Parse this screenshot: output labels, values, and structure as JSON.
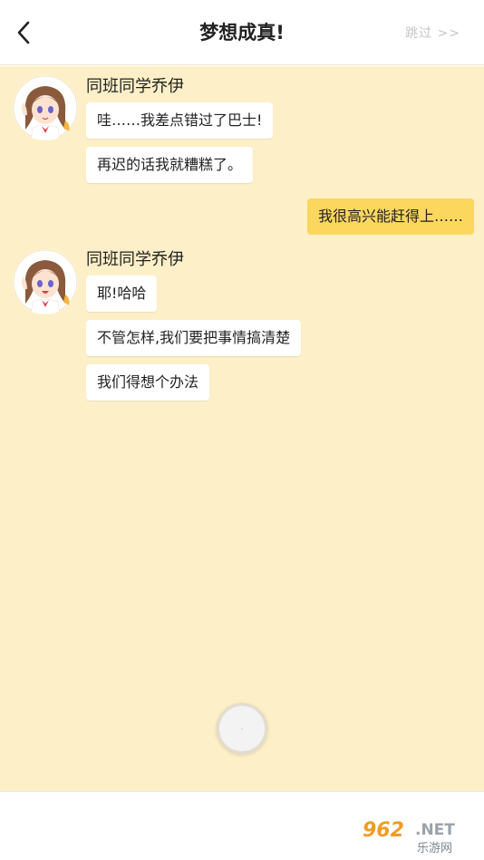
{
  "header": {
    "title": "梦想成真!",
    "skip_label": "跳过 >>",
    "back_icon": "chevron-left-icon"
  },
  "chat": {
    "background": "#fdefc7",
    "messages_group_1": {
      "speaker": "同班同学乔伊",
      "bubbles": [
        "哇……我差点错过了巴士!",
        "再迟的话我就糟糕了。"
      ]
    },
    "self_message": "我很高兴能赶得上……",
    "messages_group_2": {
      "speaker": "同班同学乔伊",
      "bubbles": [
        "耶!哈哈",
        "不管怎样,我们要把事情搞清楚",
        "我们得想个办法"
      ]
    }
  },
  "colors": {
    "self_bubble": "#fcd75e",
    "chat_bg": "#fdefc7"
  },
  "watermark": {
    "top": "962.NET",
    "bottom": "乐游网"
  }
}
